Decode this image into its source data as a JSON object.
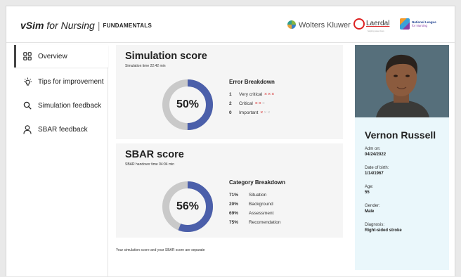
{
  "brand": {
    "v": "vSim",
    "for": "for Nursing",
    "fundamentals": "FUNDAMENTALS"
  },
  "partners": {
    "wolters_kluwer": "Wolters Kluwer",
    "laerdal": "Laerdal",
    "laerdal_sub": "helping save lives",
    "nln_line1": "National League",
    "nln_line2": "for Nursing"
  },
  "sidebar": {
    "items": [
      {
        "label": "Overview",
        "icon": "grid-icon"
      },
      {
        "label": "Tips for improvement",
        "icon": "lightbulb-icon"
      },
      {
        "label": "Simulation feedback",
        "icon": "search-icon"
      },
      {
        "label": "SBAR feedback",
        "icon": "person-icon"
      }
    ]
  },
  "simulation": {
    "title": "Simulation score",
    "time": "Simulation time 22:42 min",
    "score": 0.5,
    "score_label": "50%",
    "breakdown_title": "Error Breakdown",
    "errors": [
      {
        "count": "1",
        "label": "Very critical",
        "marks": "×××",
        "active": 3
      },
      {
        "count": "2",
        "label": "Critical",
        "marks": "×××",
        "active": 2
      },
      {
        "count": "0",
        "label": "Important",
        "marks": "×××",
        "active": 1
      }
    ]
  },
  "sbar": {
    "title": "SBAR score",
    "time": "SBAR handover time 04:04 min",
    "score": 0.56,
    "score_label": "56%",
    "breakdown_title": "Category Breakdown",
    "categories": [
      {
        "pct": "71%",
        "label": "Situation"
      },
      {
        "pct": "20%",
        "label": "Background"
      },
      {
        "pct": "69%",
        "label": "Assessment"
      },
      {
        "pct": "75%",
        "label": "Recomendation"
      }
    ]
  },
  "note": "Your simulation score and your SBAR score are separate",
  "patient": {
    "name": "Vernon Russell",
    "adm_label": "Adm on:",
    "adm": "04/24/2022",
    "dob_label": "Date of birth:",
    "dob": "1/14/1967",
    "age_label": "Age:",
    "age": "55",
    "gender_label": "Gender:",
    "gender": "Male",
    "diagnosis_label": "Diagnosis:",
    "diagnosis": "Right-sided stroke"
  },
  "colors": {
    "donut_fill": "#4b5faa",
    "donut_track": "#c9c9c9",
    "error_mark": "#d83a3a",
    "patient_bg": "#eaf7fb"
  }
}
